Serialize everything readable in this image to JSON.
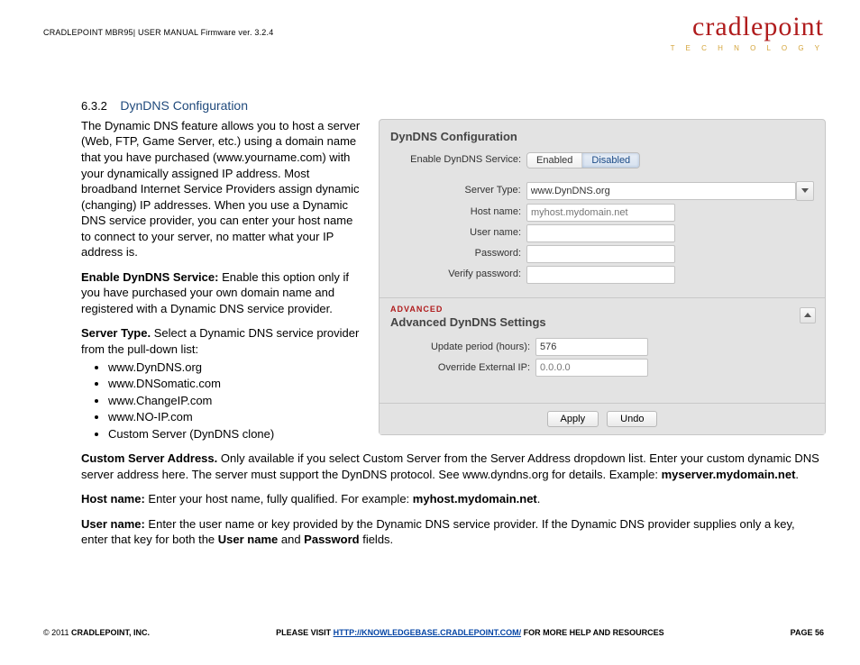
{
  "header": {
    "text": "CRADLEPOINT MBR95| USER MANUAL Firmware ver. 3.2.4"
  },
  "logo": {
    "main": "cradlepoint",
    "sub": "T E C H N O L O G Y"
  },
  "section": {
    "number": "6.3.2",
    "title": "DynDNS Configuration"
  },
  "intro": "The Dynamic DNS feature allows you to host a server (Web, FTP, Game Server, etc.) using a domain name that you have purchased (www.yourname.com) with your dynamically assigned IP address. Most broadband Internet Service Providers assign dynamic (changing) IP addresses. When you use a Dynamic DNS service provider, you can enter your host name to connect to your server, no matter what your IP address is.",
  "enable": {
    "label": "Enable DynDNS Service:",
    "text": " Enable this option only if you have purchased your own domain name and registered with a Dynamic DNS service provider."
  },
  "serverType": {
    "label": "Server Type.",
    "text": " Select a Dynamic DNS service provider from the pull-down list:"
  },
  "providers": [
    "www.DynDNS.org",
    "www.DNSomatic.com",
    "www.ChangeIP.com",
    "www.NO-IP.com",
    "Custom Server (DynDNS clone)"
  ],
  "custom": {
    "label": "Custom Server Address.",
    "t1": " Only available if you select Custom Server from the Server Address dropdown list. Enter your custom dynamic DNS server address here. The server must support the DynDNS protocol. See www.dyndns.org for details. Example: ",
    "ex": "myserver.mydomain.net",
    "t2": "."
  },
  "host": {
    "label": "Host name:",
    "t1": " Enter your host name, fully qualified. For example: ",
    "ex": "myhost.mydomain.net",
    "t2": "."
  },
  "user": {
    "label": "User name:",
    "t1": " Enter the user name or key provided by the Dynamic DNS service provider. If the Dynamic DNS provider supplies only a key, enter that key for both the ",
    "b1": "User name",
    "t2": " and ",
    "b2": "Password",
    "t3": " fields."
  },
  "panel": {
    "title": "DynDNS Configuration",
    "labels": {
      "enable": "Enable DynDNS Service:",
      "serverType": "Server Type:",
      "hostName": "Host name:",
      "userName": "User name:",
      "password": "Password:",
      "verify": "Verify password:",
      "update": "Update period (hours):",
      "override": "Override External IP:"
    },
    "buttons": {
      "enabled": "Enabled",
      "disabled": "Disabled",
      "apply": "Apply",
      "undo": "Undo"
    },
    "values": {
      "serverType": "www.DynDNS.org",
      "hostPlaceholder": "myhost.mydomain.net",
      "update": "576",
      "overridePlaceholder": "0.0.0.0"
    },
    "advanced": {
      "kicker": "ADVANCED",
      "title": "Advanced DynDNS Settings"
    }
  },
  "footer": {
    "left1": "© 2011 ",
    "left2": "CRADLEPOINT, INC.",
    "mid1": "PLEASE VISIT ",
    "midlink": "HTTP://KNOWLEDGEBASE.CRADLEPOINT.COM/",
    "mid2": " FOR MORE HELP AND RESOURCES",
    "right": "PAGE 56"
  }
}
